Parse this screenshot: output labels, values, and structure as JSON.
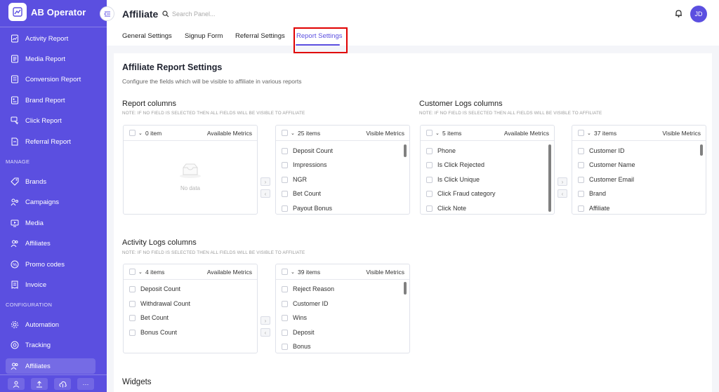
{
  "app": {
    "name": "AB Operator"
  },
  "sidebar": {
    "items": [
      {
        "label": "Activity Report",
        "icon": "activity-report-icon"
      },
      {
        "label": "Media Report",
        "icon": "media-report-icon"
      },
      {
        "label": "Conversion Report",
        "icon": "conversion-report-icon"
      },
      {
        "label": "Brand Report",
        "icon": "brand-report-icon"
      },
      {
        "label": "Click Report",
        "icon": "click-report-icon"
      },
      {
        "label": "Referral Report",
        "icon": "referral-report-icon"
      }
    ],
    "manage_label": "MANAGE",
    "manage_items": [
      {
        "label": "Brands",
        "icon": "tag-icon"
      },
      {
        "label": "Campaigns",
        "icon": "campaigns-icon"
      },
      {
        "label": "Media",
        "icon": "media-icon"
      },
      {
        "label": "Affiliates",
        "icon": "users-icon"
      },
      {
        "label": "Promo codes",
        "icon": "promo-icon"
      },
      {
        "label": "Invoice",
        "icon": "invoice-icon"
      }
    ],
    "config_label": "CONFIGURATION",
    "config_items": [
      {
        "label": "Automation",
        "icon": "automation-icon"
      },
      {
        "label": "Tracking",
        "icon": "tracking-icon"
      },
      {
        "label": "Affiliates",
        "icon": "users-icon",
        "active": true
      }
    ],
    "footer_icons": [
      "user-icon",
      "upload-icon",
      "cloud-upload-icon",
      "more-icon"
    ],
    "footer_more": "···"
  },
  "header": {
    "title": "Affiliate",
    "search_placeholder": "Search Panel...",
    "avatar_initials": "JD",
    "tabs": [
      {
        "label": "General Settings"
      },
      {
        "label": "Signup Form"
      },
      {
        "label": "Referral Settings"
      },
      {
        "label": "Report Settings",
        "active": true
      }
    ]
  },
  "colors": {
    "accent": "#5b4fe0",
    "highlight": "#e00000"
  },
  "content": {
    "title": "Affiliate Report Settings",
    "description": "Configure the fields which will be visible to affiliate in various reports",
    "note": "NOTE: IF NO FIELD IS SELECTED THEN ALL FIELDS WILL BE VISIBLE TO AFFILIATE",
    "widgets_title": "Widgets",
    "groups": [
      {
        "title": "Report columns",
        "available": {
          "count": "0 item",
          "title": "Available Metrics",
          "items": [],
          "empty_text": "No data"
        },
        "visible": {
          "count": "25 items",
          "title": "Visible Metrics",
          "items": [
            "Deposit Count",
            "Impressions",
            "NGR",
            "Bet Count",
            "Payout Bonus"
          ]
        }
      },
      {
        "title": "Customer Logs columns",
        "available": {
          "count": "5 items",
          "title": "Available Metrics",
          "items": [
            "Phone",
            "Is Click Rejected",
            "Is Click Unique",
            "Click Fraud category",
            "Click Note"
          ]
        },
        "visible": {
          "count": "37 items",
          "title": "Visible Metrics",
          "items": [
            "Customer ID",
            "Customer Name",
            "Customer Email",
            "Brand",
            "Affiliate"
          ]
        }
      },
      {
        "title": "Activity Logs columns",
        "available": {
          "count": "4 items",
          "title": "Available Metrics",
          "items": [
            "Deposit Count",
            "Withdrawal Count",
            "Bet Count",
            "Bonus Count"
          ]
        },
        "visible": {
          "count": "39 items",
          "title": "Visible Metrics",
          "items": [
            "Reject Reason",
            "Customer ID",
            "Wins",
            "Deposit",
            "Bonus"
          ]
        }
      }
    ],
    "arrow_right": "›",
    "arrow_left": "‹"
  }
}
